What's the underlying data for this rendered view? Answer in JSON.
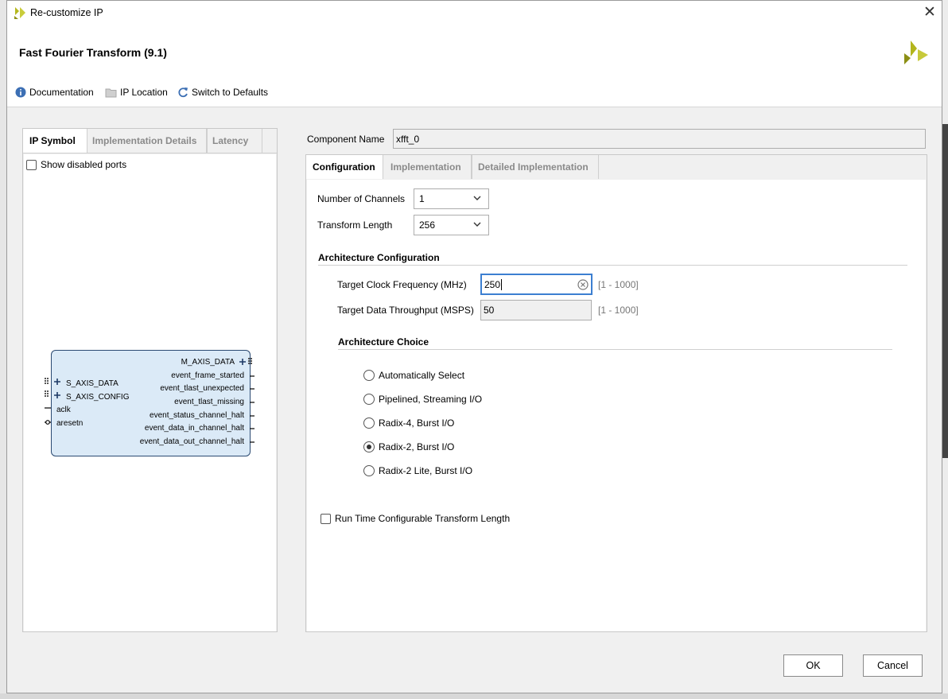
{
  "window": {
    "title": "Re-customize IP",
    "close_glyph": "✕"
  },
  "header": {
    "title": "Fast Fourier Transform (9.1)"
  },
  "toolbar": {
    "documentation": "Documentation",
    "ip_location": "IP Location",
    "switch_defaults": "Switch to Defaults"
  },
  "left_tabs": [
    "IP Symbol",
    "Implementation Details",
    "Latency"
  ],
  "show_disabled_ports": "Show disabled ports",
  "symbol": {
    "left_ports": [
      "S_AXIS_DATA",
      "S_AXIS_CONFIG",
      "aclk",
      "aresetn"
    ],
    "right_ports": [
      "M_AXIS_DATA",
      "event_frame_started",
      "event_tlast_unexpected",
      "event_tlast_missing",
      "event_status_channel_halt",
      "event_data_in_channel_halt",
      "event_data_out_channel_halt"
    ]
  },
  "component": {
    "label": "Component Name",
    "value": "xfft_0"
  },
  "right_tabs": [
    "Configuration",
    "Implementation",
    "Detailed Implementation"
  ],
  "config": {
    "channels_label": "Number of Channels",
    "channels_value": "1",
    "length_label": "Transform Length",
    "length_value": "256",
    "arch_config_header": "Architecture Configuration",
    "clock_label": "Target Clock Frequency (MHz)",
    "clock_value": "250",
    "clock_range": "[1 - 1000]",
    "throughput_label": "Target Data Throughput (MSPS)",
    "throughput_value": "50",
    "throughput_range": "[1 - 1000]",
    "arch_choice_header": "Architecture Choice",
    "arch_options": [
      "Automatically Select",
      "Pipelined, Streaming I/O",
      "Radix-4, Burst I/O",
      "Radix-2, Burst I/O",
      "Radix-2 Lite, Burst I/O"
    ],
    "arch_selected": "Radix-2, Burst I/O",
    "runtime_label": "Run Time Configurable Transform Length"
  },
  "buttons": {
    "ok": "OK",
    "cancel": "Cancel"
  },
  "colors": {
    "brand": "#a4a81c",
    "accent": "#3c7fd1",
    "border": "#c8c8c8"
  }
}
